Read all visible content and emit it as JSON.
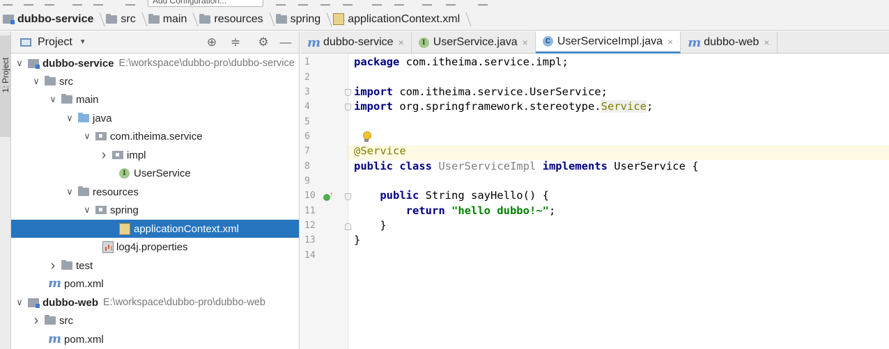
{
  "toolbar": {
    "run_config": "Add Configuration..."
  },
  "breadcrumb": [
    {
      "label": "dubbo-service",
      "icon": "module-icon"
    },
    {
      "label": "src",
      "icon": "folder-icon"
    },
    {
      "label": "main",
      "icon": "folder-icon"
    },
    {
      "label": "resources",
      "icon": "folder-icon"
    },
    {
      "label": "spring",
      "icon": "folder-icon"
    },
    {
      "label": "applicationContext.xml",
      "icon": "xml-file-icon"
    }
  ],
  "left_stripe": {
    "tab_label": "1: Project"
  },
  "project_panel": {
    "title": "Project",
    "tree": [
      {
        "name": "dubbo-service",
        "path": "E:\\workspace\\dubbo-pro\\dubbo-service",
        "icon": "module-icon",
        "expanded": true
      },
      {
        "name": "src",
        "icon": "folder-icon",
        "expanded": true
      },
      {
        "name": "main",
        "icon": "folder-icon",
        "expanded": true
      },
      {
        "name": "java",
        "icon": "source-folder-icon",
        "expanded": true
      },
      {
        "name": "com.itheima.service",
        "icon": "package-icon",
        "expanded": true
      },
      {
        "name": "impl",
        "icon": "package-icon",
        "expanded": false
      },
      {
        "name": "UserService",
        "icon": "interface-icon"
      },
      {
        "name": "resources",
        "icon": "resources-folder-icon",
        "expanded": true
      },
      {
        "name": "spring",
        "icon": "package-icon",
        "expanded": true
      },
      {
        "name": "applicationContext.xml",
        "icon": "xml-file-icon",
        "selected": true
      },
      {
        "name": "log4j.properties",
        "icon": "properties-file-icon"
      },
      {
        "name": "test",
        "icon": "folder-icon",
        "expanded": false
      },
      {
        "name": "pom.xml",
        "icon": "maven-icon"
      },
      {
        "name": "dubbo-web",
        "path": "E:\\workspace\\dubbo-pro\\dubbo-web",
        "icon": "module-icon",
        "expanded": true
      },
      {
        "name": "src",
        "icon": "folder-icon",
        "expanded": false
      },
      {
        "name": "pom.xml",
        "icon": "maven-icon"
      }
    ]
  },
  "editor": {
    "tabs": [
      {
        "label": "dubbo-service",
        "icon": "maven-icon",
        "close": "×",
        "active": false
      },
      {
        "label": "UserService.java",
        "icon": "interface-icon",
        "close": "×",
        "active": false
      },
      {
        "label": "UserServiceImpl.java",
        "icon": "class-icon",
        "close": "×",
        "active": true
      },
      {
        "label": "dubbo-web",
        "icon": "maven-icon",
        "close": "×",
        "active": false
      }
    ],
    "line_numbers": [
      "1",
      "2",
      "3",
      "4",
      "5",
      "6",
      "7",
      "8",
      "9",
      "10",
      "11",
      "12",
      "13",
      "14"
    ],
    "code": {
      "l1_kw": "package",
      "l1_rest": " com.itheima.service.impl;",
      "l3_kw": "import",
      "l3_rest": " com.itheima.service.UserService;",
      "l4_kw": "import",
      "l4_rest": " org.springframework.stereotype.",
      "l4_hl": "Service",
      "l4_end": ";",
      "l7_ann": "@Service",
      "l8_kw1": "public class",
      "l8_cls": " UserServiceImpl",
      "l8_kw2": " implements",
      "l8_rest": " UserService {",
      "l10_indent": "    ",
      "l10_kw": "public",
      "l10_rest": " String sayHello() {",
      "l11_indent": "        ",
      "l11_kw": "return",
      "l11_str": " \"hello dubbo!~\"",
      "l11_end": ";",
      "l12": "    }",
      "l13": "}"
    }
  }
}
